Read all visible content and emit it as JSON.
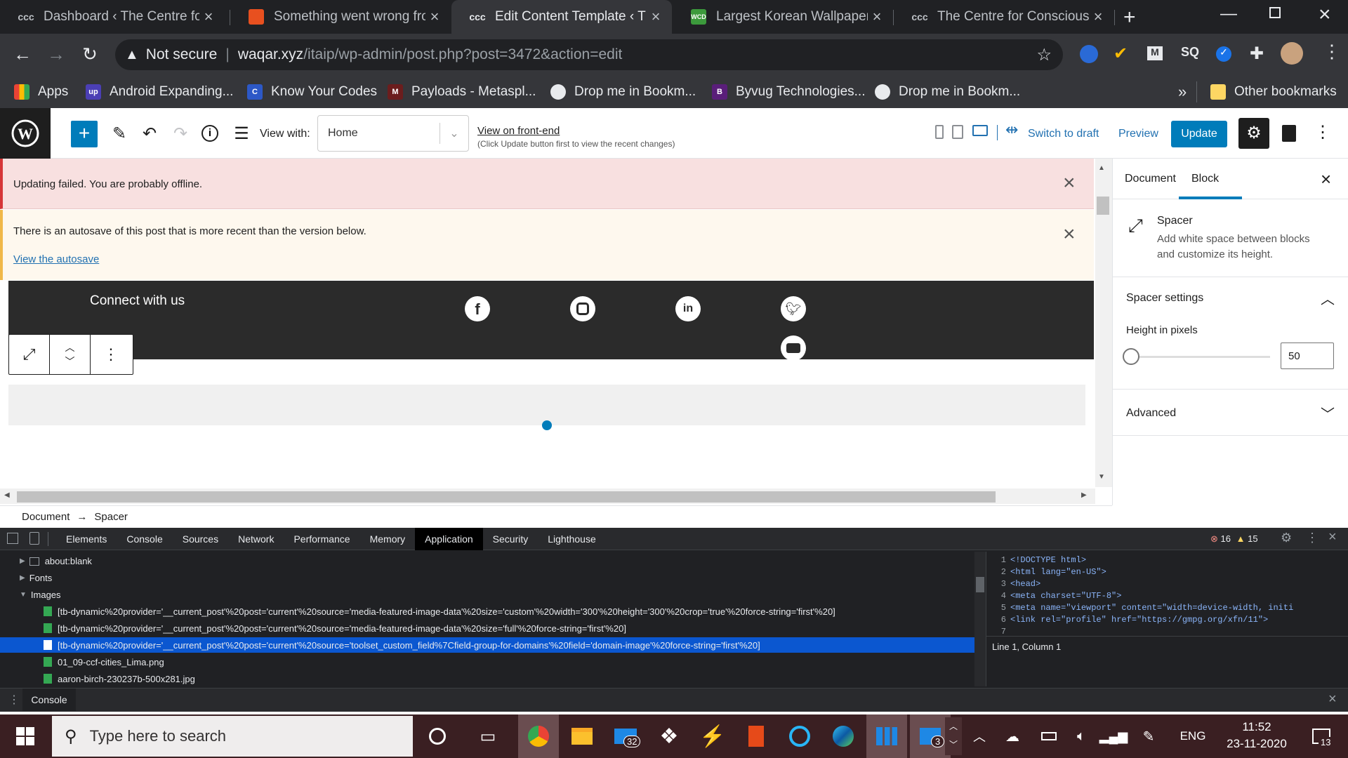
{
  "browser": {
    "tabs": [
      {
        "title": "Dashboard ‹ The Centre for Conscious",
        "favicon": "wp-icon"
      },
      {
        "title": "Something went wrong from",
        "favicon": "orange-square-icon"
      },
      {
        "title": "Edit Content Template ‹ The Centre",
        "favicon": "wp-icon"
      },
      {
        "title": "Largest Korean Wallpaper & HD",
        "favicon": "wcd-icon"
      },
      {
        "title": "The Centre for Conscious Design",
        "favicon": "wp-icon"
      }
    ],
    "security_label": "Not secure",
    "url_domain": "waqar.xyz",
    "url_path": "/itaip/wp-admin/post.php?post=3472&action=edit",
    "bookmarks": [
      {
        "label": "Apps",
        "icon": "apps-grid-icon"
      },
      {
        "label": "Android Expanding...",
        "icon": "upwork-icon"
      },
      {
        "label": "Know Your Codes",
        "icon": "kyc-icon"
      },
      {
        "label": "Payloads - Metaspl...",
        "icon": "metasploit-icon"
      },
      {
        "label": "Drop me in Bookm...",
        "icon": "globe-icon"
      },
      {
        "label": "Byvug Technologies...",
        "icon": "byvug-icon"
      },
      {
        "label": "Drop me in Bookm...",
        "icon": "globe-icon"
      }
    ],
    "overflow_label": "»",
    "other_bookmarks": "Other bookmarks"
  },
  "wp_toolbar": {
    "view_with_label": "View with:",
    "view_with_value": "Home",
    "view_frontend_link": "View on front-end",
    "view_frontend_note": "(Click Update button first to view the recent changes)",
    "switch_to_draft": "Switch to draft",
    "preview": "Preview",
    "update": "Update"
  },
  "notices": {
    "error_text": "Updating failed. You are probably offline.",
    "autosave_text": "There is an autosave of this post that is more recent than the version below.",
    "autosave_link": "View the autosave"
  },
  "canvas": {
    "connect_heading": "Connect with us",
    "social_icons": [
      "facebook-icon",
      "instagram-icon",
      "linkedin-icon",
      "twitter-icon",
      "youtube-icon"
    ]
  },
  "breadcrumb": {
    "root": "Document",
    "sep": "→",
    "current": "Spacer"
  },
  "sidebar": {
    "tab_document": "Document",
    "tab_block": "Block",
    "block_name": "Spacer",
    "block_desc_line1": "Add white space between blocks",
    "block_desc_line2": "and customize its height.",
    "settings_title": "Spacer settings",
    "height_label": "Height in pixels",
    "height_value": "50",
    "height_fraction": 0.0,
    "advanced_title": "Advanced"
  },
  "devtools": {
    "tabs": [
      "Elements",
      "Console",
      "Sources",
      "Network",
      "Performance",
      "Memory",
      "Application",
      "Security",
      "Lighthouse"
    ],
    "active_tab": "Application",
    "error_count": "16",
    "warning_count": "15",
    "tree": [
      {
        "label": "about:blank",
        "kind": "frame"
      },
      {
        "label": "Fonts",
        "kind": "folder"
      },
      {
        "label": "Images",
        "kind": "folder-open"
      }
    ],
    "images": [
      "[tb-dynamic%20provider='__current_post'%20post='current'%20source='media-featured-image-data'%20size='custom'%20width='300'%20height='300'%20crop='true'%20force-string='first'%20]",
      "[tb-dynamic%20provider='__current_post'%20post='current'%20source='media-featured-image-data'%20size='full'%20force-string='first'%20]",
      "[tb-dynamic%20provider='__current_post'%20post='current'%20source='toolset_custom_field%7Cfield-group-for-domains'%20field='domain-image'%20force-string='first'%20]",
      "01_09-ccf-cities_Lima.png",
      "aaron-birch-230237b-500x281.jpg"
    ],
    "selected_image_index": 2,
    "code_lines": [
      {
        "n": "1",
        "code": "<!DOCTYPE html>"
      },
      {
        "n": "2",
        "code": "<html lang=\"en-US\">"
      },
      {
        "n": "3",
        "code": "<head>"
      },
      {
        "n": "4",
        "code": "<meta charset=\"UTF-8\">"
      },
      {
        "n": "5",
        "code": "<meta name=\"viewport\" content=\"width=device-width, initi"
      },
      {
        "n": "6",
        "code": "<link rel=\"profile\" href=\"https://gmpg.org/xfn/11\">"
      },
      {
        "n": "7",
        "code": ""
      }
    ],
    "cursor_status": "Line 1, Column 1",
    "drawer_tab": "Console"
  },
  "taskbar": {
    "search_placeholder": "Type here to search",
    "mail_badge": "32",
    "chat_badge": "3",
    "language": "ENG",
    "time": "11:52",
    "date": "23-11-2020",
    "notification_count": "13"
  }
}
